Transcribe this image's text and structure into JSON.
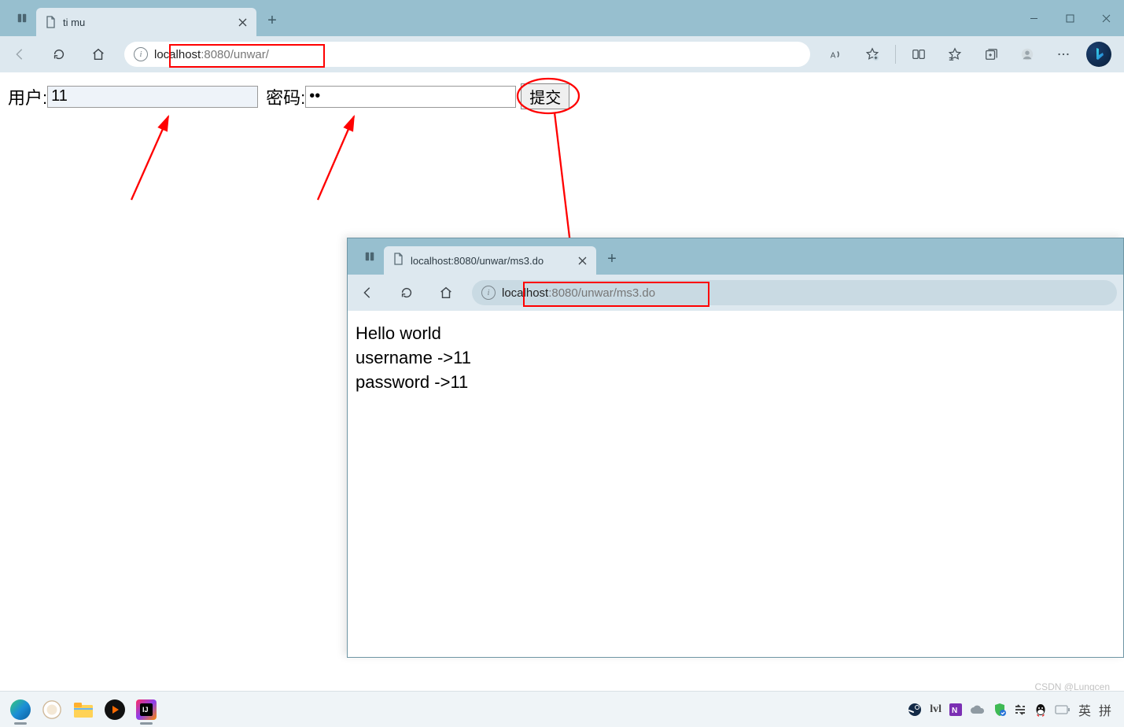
{
  "window1": {
    "tab_title": "ti mu",
    "url_host": "localhost",
    "url_rest": ":8080/unwar/",
    "form": {
      "user_label": "用户:",
      "user_value": "11",
      "pass_label": "密码:",
      "pass_value": "••",
      "submit_label": "提交"
    }
  },
  "window2": {
    "tab_title": "localhost:8080/unwar/ms3.do",
    "url_host": "localhost",
    "url_rest": ":8080/unwar/ms3.do",
    "body_line1": "Hello world",
    "body_line2": "username ->11",
    "body_line3": "password ->11"
  },
  "tray": {
    "ime1": "英",
    "ime2": "拼"
  },
  "watermark": "CSDN @Lungcen"
}
